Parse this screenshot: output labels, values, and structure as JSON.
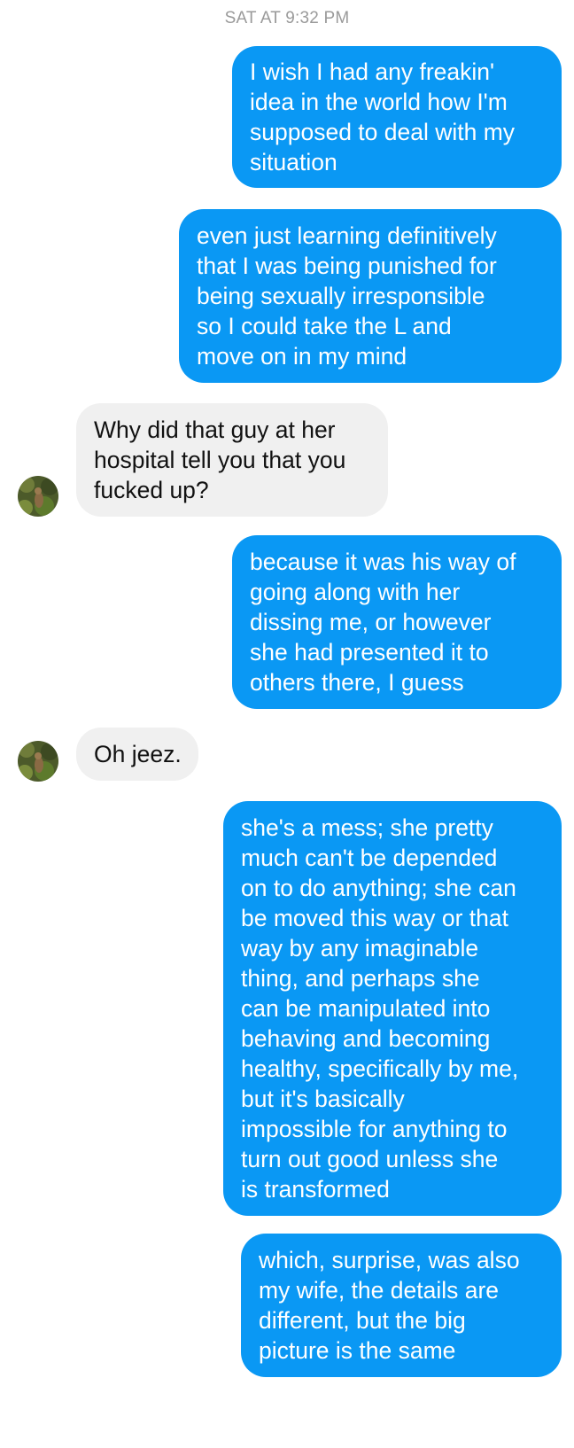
{
  "conversation": {
    "timestamp": "SAT AT 9:32 PM",
    "messages": [
      {
        "direction": "outgoing",
        "text": "I wish I had any freakin'\nidea in the world how I'm\nsupposed to deal with my\nsituation"
      },
      {
        "direction": "outgoing",
        "text": "even just learning definitively\nthat I was being punished for\nbeing sexually irresponsible\nso I could take the L and\nmove on in my mind"
      },
      {
        "direction": "incoming",
        "text": "Why did that guy at her\nhospital tell you that you\nfucked up?",
        "avatar_icon": "contact-avatar-icon"
      },
      {
        "direction": "outgoing",
        "text": "because it was his way of\ngoing along with her\ndissing me, or however\nshe had presented it to\nothers there, I guess"
      },
      {
        "direction": "incoming",
        "text": "Oh jeez.",
        "avatar_icon": "contact-avatar-icon"
      },
      {
        "direction": "outgoing",
        "text": "she's a mess; she pretty\nmuch can't be depended\non to do anything; she can\nbe moved this way or that\nway by any imaginable\nthing, and perhaps she\ncan be manipulated into\nbehaving and becoming\nhealthy, specifically by me,\nbut it's basically\nimpossible for anything to\nturn out good unless she\nis transformed"
      },
      {
        "direction": "outgoing",
        "text": "which, surprise, was also\nmy wife, the details are\ndifferent, but the big\npicture is the same"
      }
    ]
  },
  "colors": {
    "outgoing_bubble": "#0a98f4",
    "incoming_bubble": "#f0f0f0",
    "timestamp_text": "#9a9a9a"
  }
}
